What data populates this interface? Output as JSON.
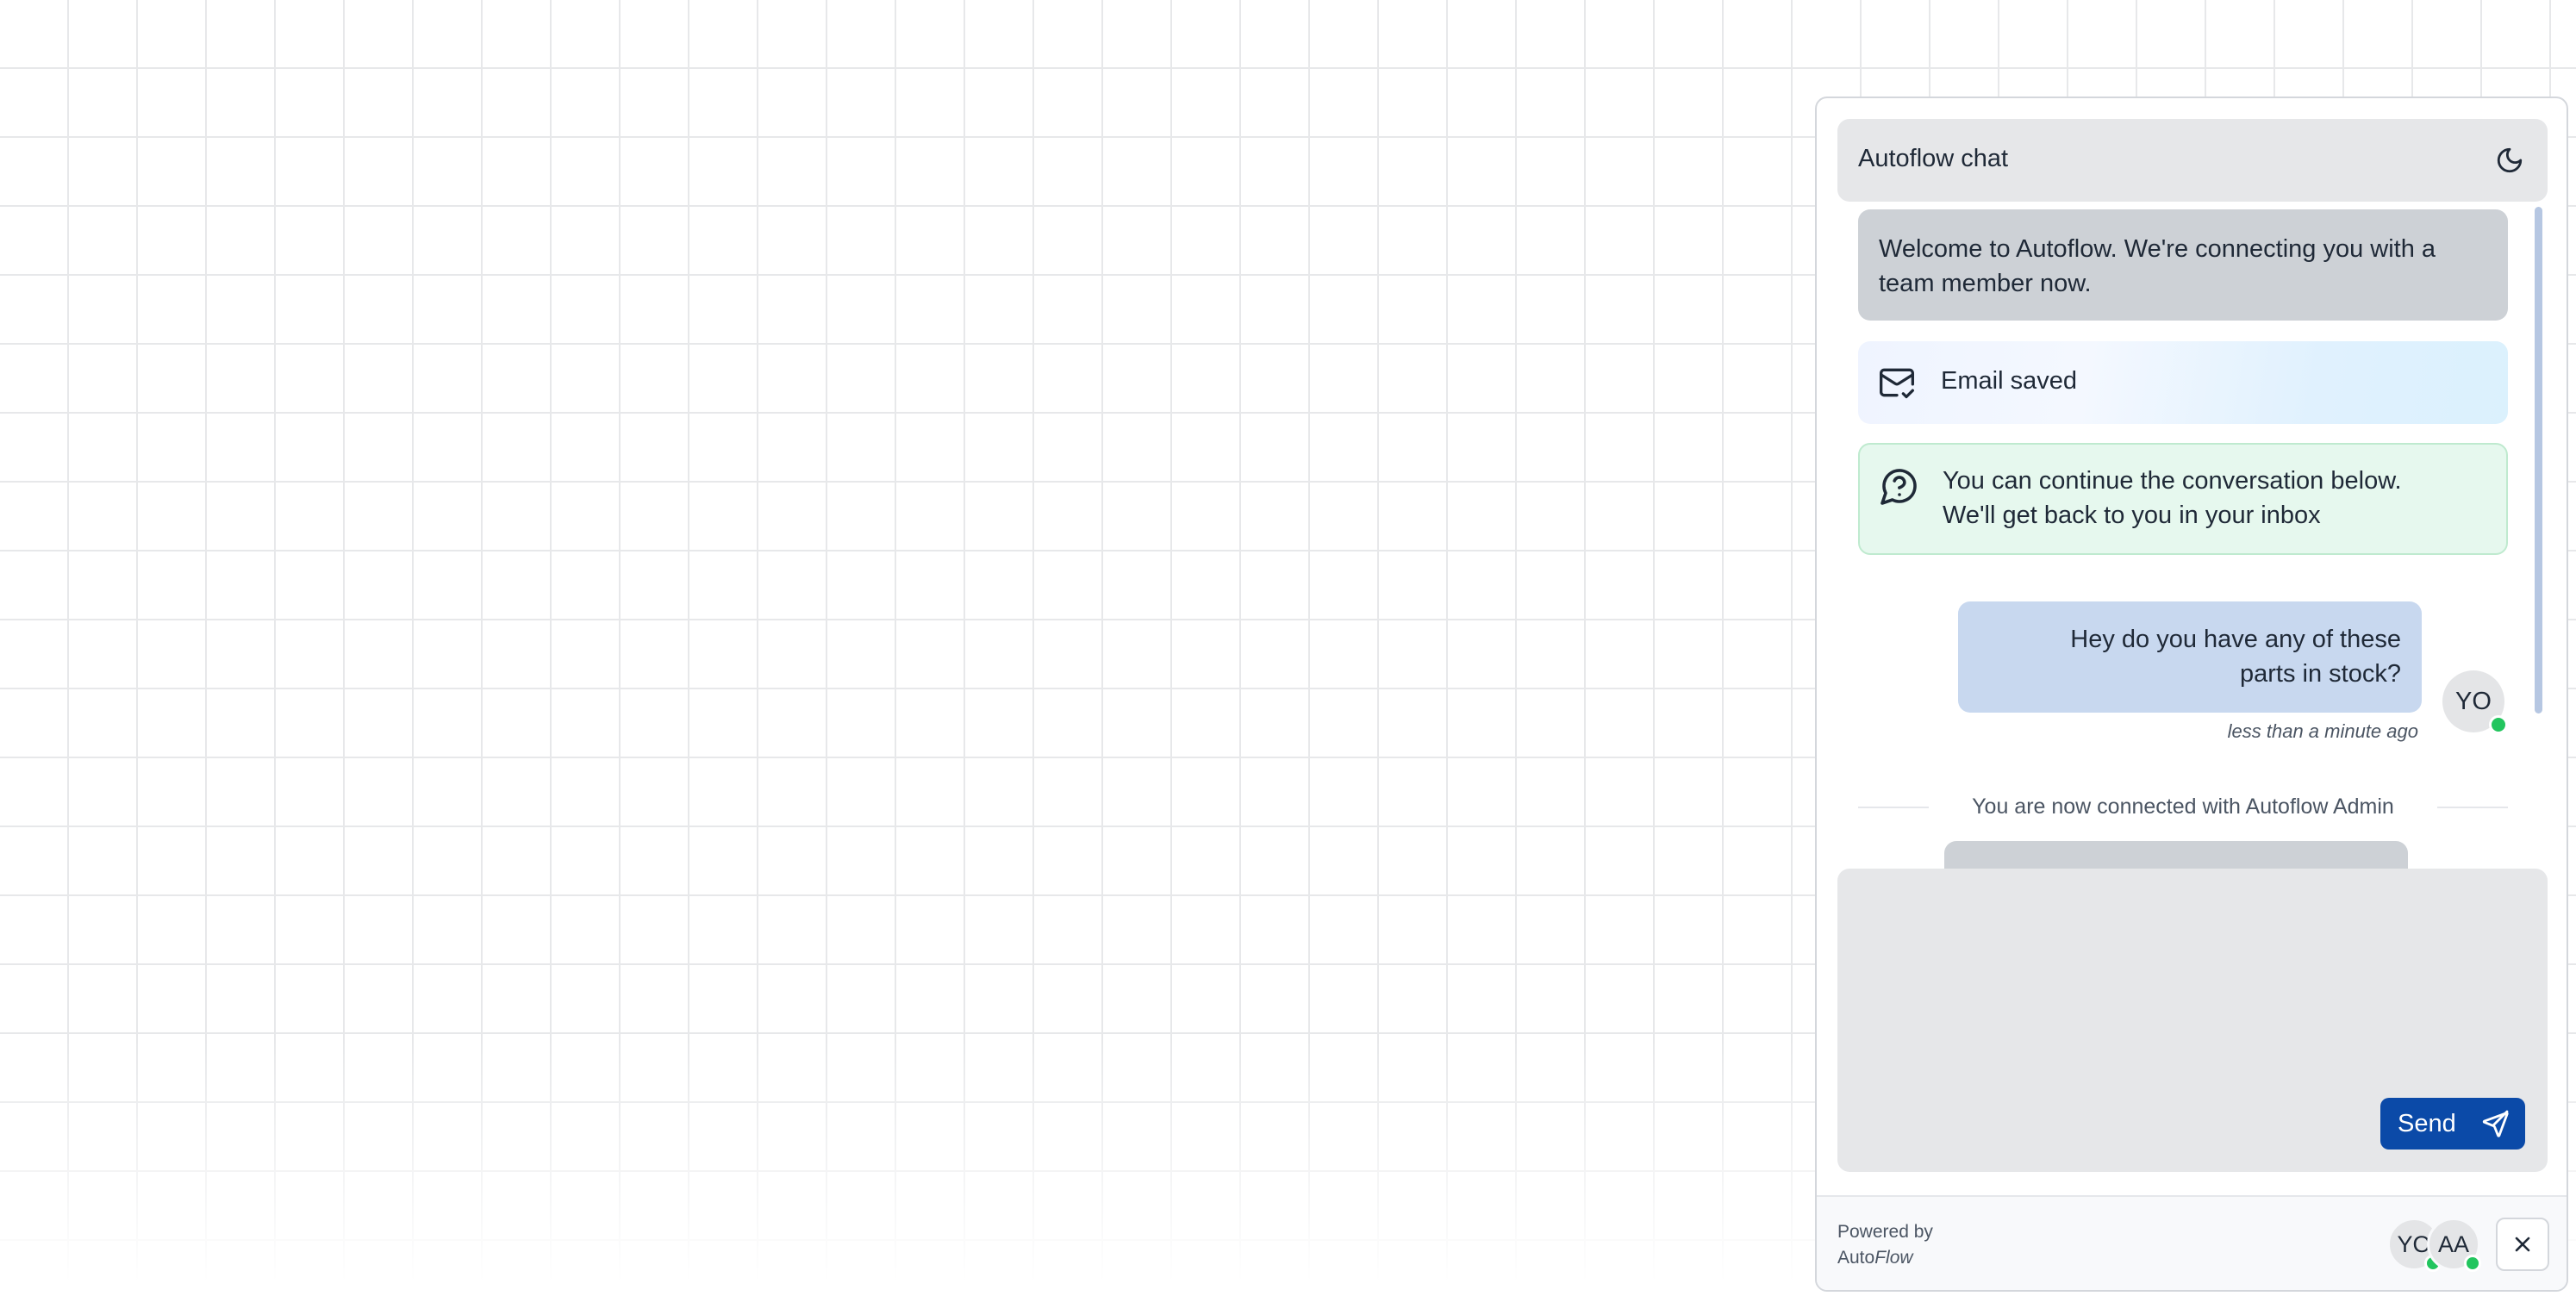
{
  "header": {
    "title": "Autoflow chat",
    "theme_icon": "moon-icon"
  },
  "messages": {
    "system_welcome": "Welcome to Autoflow. We're connecting you with a team member now.",
    "email_saved": {
      "icon": "mail-check-icon",
      "label": "Email saved"
    },
    "continue_note": {
      "icon": "help-circle-icon",
      "line1": "You can continue the conversation below.",
      "line2": "We'll get back to you in your inbox"
    },
    "user_message": {
      "line1": "Hey do you have any of these",
      "line2": "parts in stock?",
      "avatar": "YO",
      "timestamp": "less than a minute ago"
    },
    "connected_divider": "You are now connected with Autoflow Admin"
  },
  "composer": {
    "value": "",
    "send_label": "Send",
    "send_icon": "send-icon"
  },
  "footer": {
    "powered_by": "Powered by",
    "brand_auto": "Auto",
    "brand_flow": "Flow",
    "participants": [
      "YO",
      "AA"
    ],
    "close_icon": "close-icon"
  },
  "colors": {
    "accent": "#0b4aa8",
    "online": "#22c55e",
    "user_bubble": "#c8d8ef",
    "system_bubble": "#cdd1d6",
    "success_bg": "#e6f8ee"
  }
}
